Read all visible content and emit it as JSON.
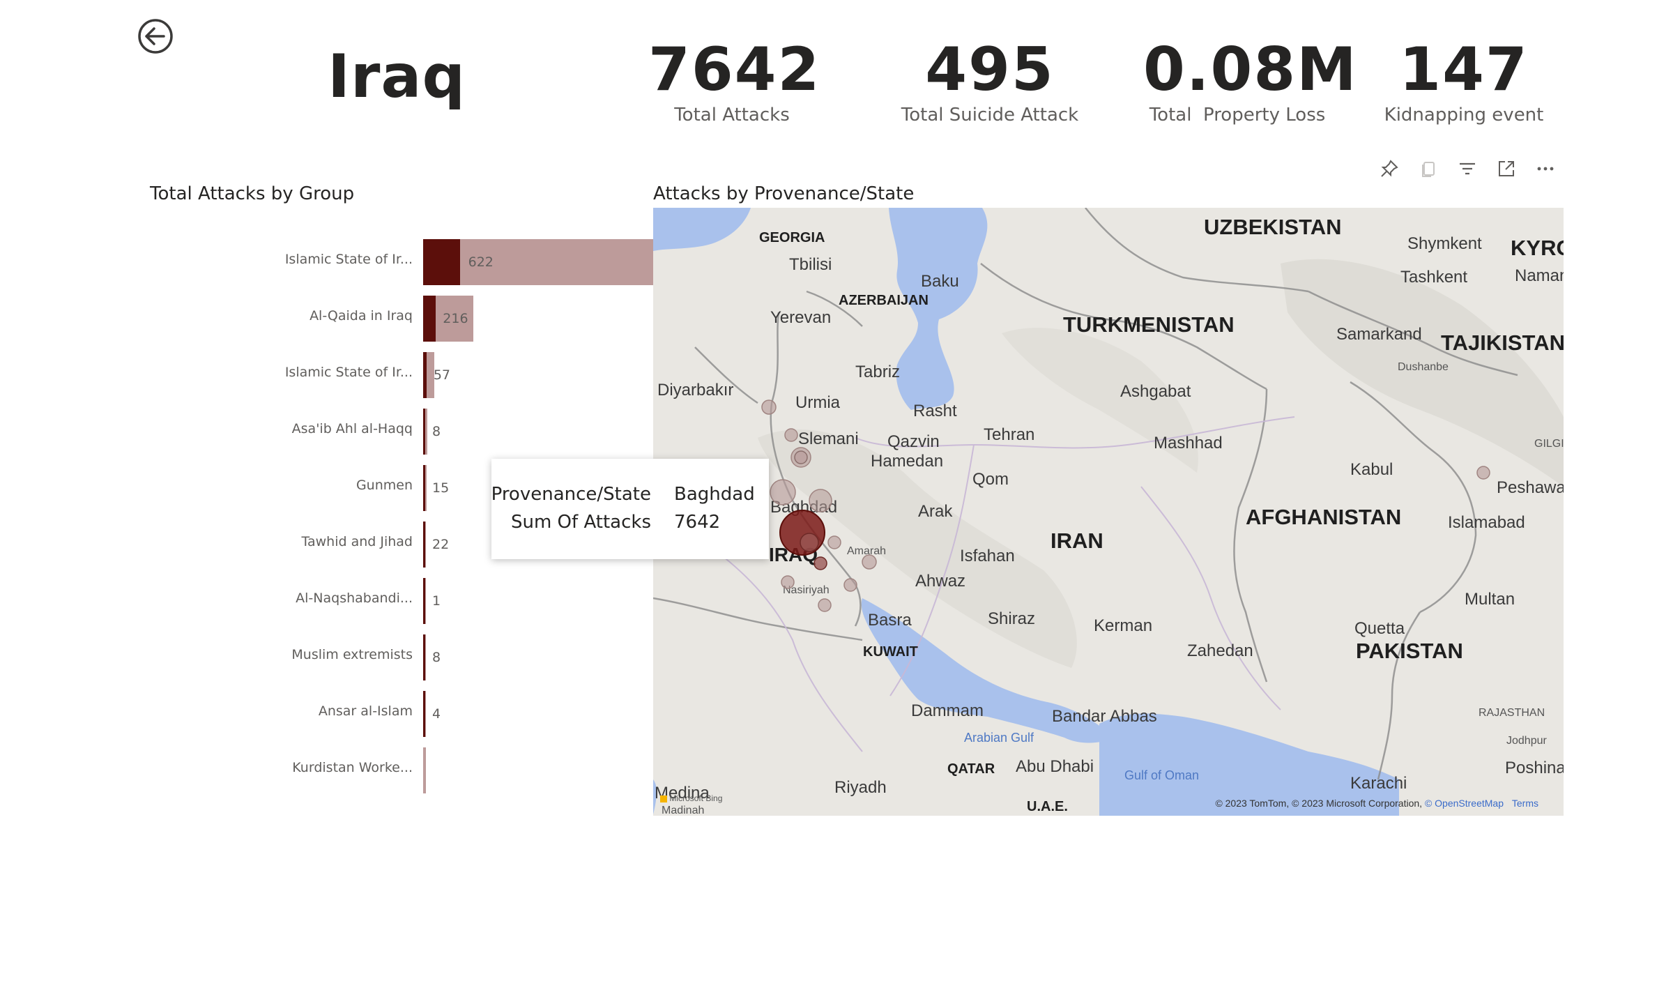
{
  "header": {
    "back_icon": "back-arrow-circle-icon",
    "country_name": "Iraq"
  },
  "kpis": [
    {
      "value": "7642",
      "label": "Total Attacks"
    },
    {
      "value": "495",
      "label": "Total Suicide Attack"
    },
    {
      "value": "0.08M",
      "label": "Total  Property Loss"
    },
    {
      "value": "147",
      "label": "Kidnapping event"
    }
  ],
  "bar_visual": {
    "title": "Total Attacks by Group"
  },
  "map_visual": {
    "title": "Attacks by Provenance/State",
    "toolbar_icons": [
      "pin-icon",
      "copy-icon",
      "filter-icon",
      "focus-mode-icon",
      "more-options-icon"
    ],
    "labels": {
      "uzbekistan": "UZBEKISTAN",
      "kyrg": "KYRG",
      "georgia": "GEORGIA",
      "azerbaijan": "AZERBAIJAN",
      "turkmenistan": "TURKMENISTAN",
      "tajikistan": "TAJIKISTAN",
      "afghanistan": "AFGHANISTAN",
      "iran": "IRAN",
      "iraq": "IRAQ",
      "pakistan": "PAKISTAN",
      "kuwait": "KUWAIT",
      "qatar": "QATAR",
      "uae": "U.A.E.",
      "tbilisi": "Tbilisi",
      "baku": "Baku",
      "yerevan": "Yerevan",
      "tabriz": "Tabriz",
      "diyarbakir": "Diyarbakır",
      "urmia": "Urmia",
      "rasht": "Rasht",
      "ashgabat": "Ashgabat",
      "samarkand": "Samarkand",
      "dushanbe": "Dushanbe",
      "shymkent": "Shymkent",
      "tashkent": "Tashkent",
      "namang": "Namang",
      "slemani": "Slemani",
      "qazvin": "Qazvin",
      "tehran": "Tehran",
      "mashhad": "Mashhad",
      "hamedan": "Hamedan",
      "qom": "Qom",
      "kabul": "Kabul",
      "gilgit": "GILGIT",
      "peshawar": "Peshawa",
      "baghdad": "Baghdad",
      "arak": "Arak",
      "islamabad": "Islamabad",
      "isfahan": "Isfahan",
      "amarah": "Amarah",
      "ahwaz": "Ahwaz",
      "nasiriyah": "Nasiriyah",
      "multan": "Multan",
      "shiraz": "Shiraz",
      "basra": "Basra",
      "kerman": "Kerman",
      "quetta": "Quetta",
      "zahedan": "Zahedan",
      "dammam": "Dammam",
      "bandar_abbas": "Bandar Abbas",
      "rajasthan": "RAJASTHAN",
      "arabian_gulf": "Arabian Gulf",
      "jodhpur": "Jodhpur",
      "abu_dhabi": "Abu Dhabi",
      "gulf_of_oman": "Gulf of Oman",
      "poshina": "Poshina",
      "karachi": "Karachi",
      "riyadh": "Riyadh",
      "medina": "Medina",
      "madinah": "Madinah"
    },
    "attribution": "© 2023 TomTom, © 2023 Microsoft Corporation,",
    "attribution_link": "© OpenStreetMap",
    "terms": "Terms",
    "bing_logo": "Microsoft Bing"
  },
  "tooltip": {
    "rows": [
      {
        "key": "Provenance/State",
        "value": "Baghdad"
      },
      {
        "key": "Sum Of Attacks",
        "value": "7642"
      }
    ]
  },
  "chart_data": {
    "type": "bar",
    "orientation": "horizontal",
    "title": "Total Attacks by Group",
    "categories": [
      "Islamic State of Ir...",
      "Al-Qaida in Iraq",
      "Islamic State of Ir...",
      "Asa'ib Ahl al-Haqq",
      "Gunmen",
      "Tawhid and Jihad",
      "Al-Naqshabandi...",
      "Muslim extremists",
      "Ansar al-Islam",
      "Kurdistan Worke..."
    ],
    "series": [
      {
        "values": [
          622,
          216,
          57,
          8,
          15,
          22,
          1,
          8,
          4,
          null
        ]
      },
      {
        "values": [
          6500,
          1000,
          230,
          80,
          70,
          60,
          40,
          40,
          30,
          15
        ]
      }
    ],
    "colors": {
      "highlight": "#5c0f0b",
      "total": "#bd9b9a"
    },
    "xlim": [
      0,
      6500
    ]
  }
}
